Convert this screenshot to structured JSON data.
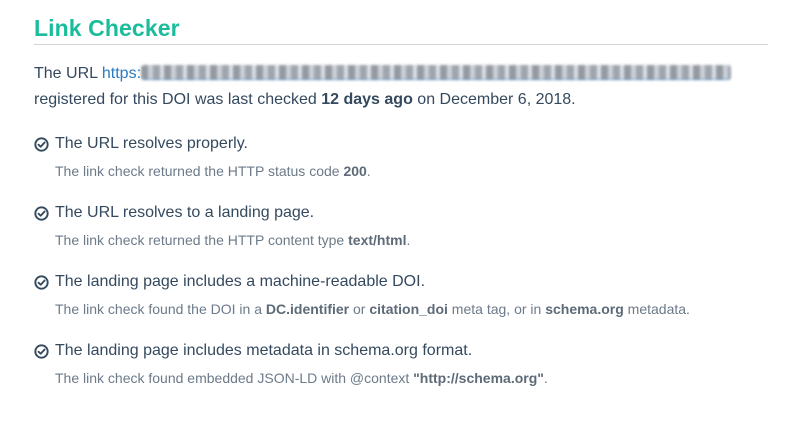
{
  "header": {
    "title": "Link Checker"
  },
  "intro": {
    "prefix": "The URL",
    "link_text": "https:",
    "line2_prefix": "registered for this DOI was last checked",
    "age": "12 days ago",
    "line2_mid": "on",
    "date": "December 6, 2018."
  },
  "checks": [
    {
      "title": "The URL resolves properly.",
      "detail": [
        {
          "text": "The link check returned the HTTP status code ",
          "bold": false
        },
        {
          "text": "200",
          "bold": true
        },
        {
          "text": ".",
          "bold": false
        }
      ]
    },
    {
      "title": "The URL resolves to a landing page.",
      "detail": [
        {
          "text": "The link check returned the HTTP content type ",
          "bold": false
        },
        {
          "text": "text/html",
          "bold": true
        },
        {
          "text": ".",
          "bold": false
        }
      ]
    },
    {
      "title": "The landing page includes a machine-readable DOI.",
      "detail": [
        {
          "text": "The link check found the DOI in a ",
          "bold": false
        },
        {
          "text": "DC.identifier",
          "bold": true
        },
        {
          "text": " or ",
          "bold": false
        },
        {
          "text": "citation_doi",
          "bold": true
        },
        {
          "text": " meta tag, or in ",
          "bold": false
        },
        {
          "text": "schema.org",
          "bold": true
        },
        {
          "text": " metadata.",
          "bold": false
        }
      ]
    },
    {
      "title": "The landing page includes metadata in schema.org format.",
      "detail": [
        {
          "text": "The link check found embedded JSON-LD with @context ",
          "bold": false
        },
        {
          "text": "\"http://schema.org\"",
          "bold": true
        },
        {
          "text": ".",
          "bold": false
        }
      ]
    }
  ],
  "colors": {
    "title": "#1abc9c",
    "text": "#34495e",
    "muted": "#6c7a89",
    "link": "#2a7bc0"
  },
  "icons": {
    "check": "check-circle-icon"
  }
}
